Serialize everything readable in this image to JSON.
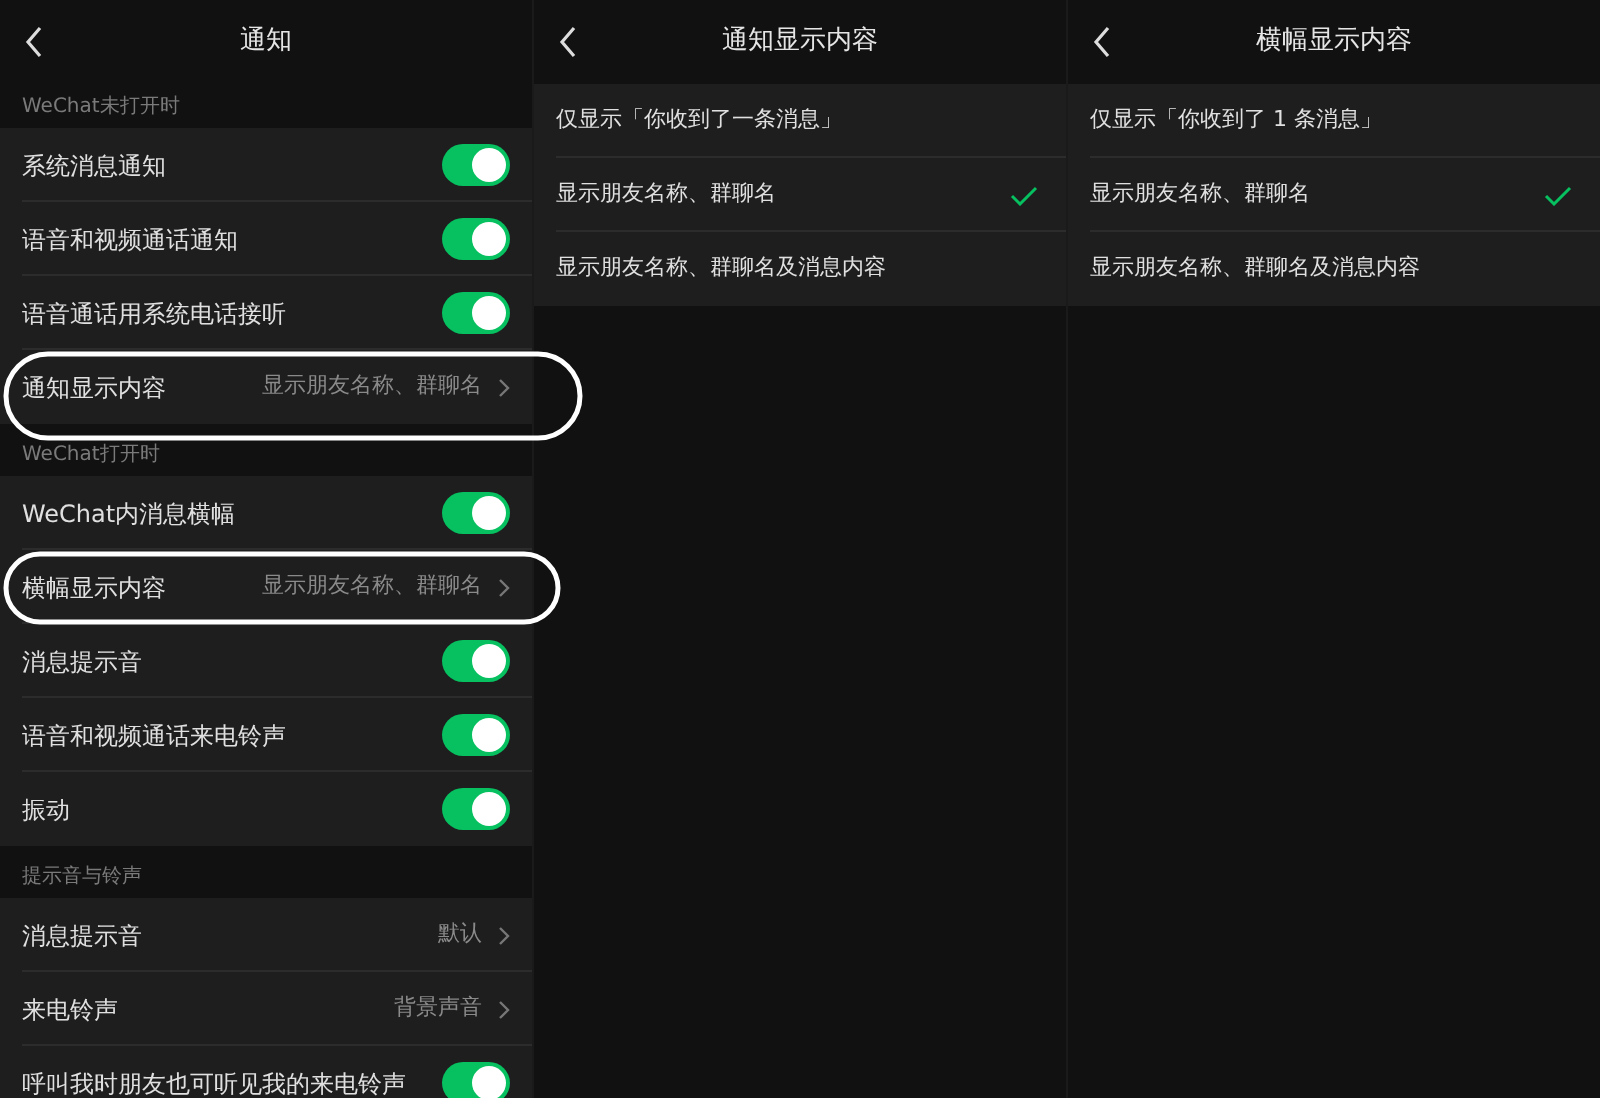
{
  "settings": {
    "title": "通知",
    "sections": [
      {
        "label": "WeChat未打开时",
        "rows": [
          {
            "kind": "toggle",
            "label": "系统消息通知",
            "on": true
          },
          {
            "kind": "toggle",
            "label": "语音和视频通话通知",
            "on": true
          },
          {
            "kind": "toggle",
            "label": "语音通话用系统电话接听",
            "on": true
          },
          {
            "kind": "link",
            "label": "通知显示内容",
            "value": "显示朋友名称、群聊名"
          }
        ]
      },
      {
        "label": "WeChat打开时",
        "rows": [
          {
            "kind": "toggle",
            "label": "WeChat内消息横幅",
            "on": true
          },
          {
            "kind": "link",
            "label": "横幅显示内容",
            "value": "显示朋友名称、群聊名"
          },
          {
            "kind": "toggle",
            "label": "消息提示音",
            "on": true
          },
          {
            "kind": "toggle",
            "label": "语音和视频通话来电铃声",
            "on": true
          },
          {
            "kind": "toggle",
            "label": "振动",
            "on": true
          }
        ]
      },
      {
        "label": "提示音与铃声",
        "rows": [
          {
            "kind": "link",
            "label": "消息提示音",
            "value": "默认"
          },
          {
            "kind": "link",
            "label": "来电铃声",
            "value": "背景声音"
          },
          {
            "kind": "toggle",
            "label": "呼叫我时朋友也可听见我的来电铃声",
            "on": true
          }
        ]
      }
    ]
  },
  "choice_screens": [
    {
      "title": "通知显示内容",
      "options": [
        {
          "label": "仅显示「你收到了一条消息」",
          "selected": false
        },
        {
          "label": "显示朋友名称、群聊名",
          "selected": true
        },
        {
          "label": "显示朋友名称、群聊名及消息内容",
          "selected": false
        }
      ]
    },
    {
      "title": "横幅显示内容",
      "options": [
        {
          "label": "仅显示「你收到了 1 条消息」",
          "selected": false
        },
        {
          "label": "显示朋友名称、群聊名",
          "selected": true
        },
        {
          "label": "显示朋友名称、群聊名及消息内容",
          "selected": false
        }
      ]
    }
  ],
  "annotations": [
    {
      "kind": "circle"
    },
    {
      "kind": "circle"
    }
  ]
}
